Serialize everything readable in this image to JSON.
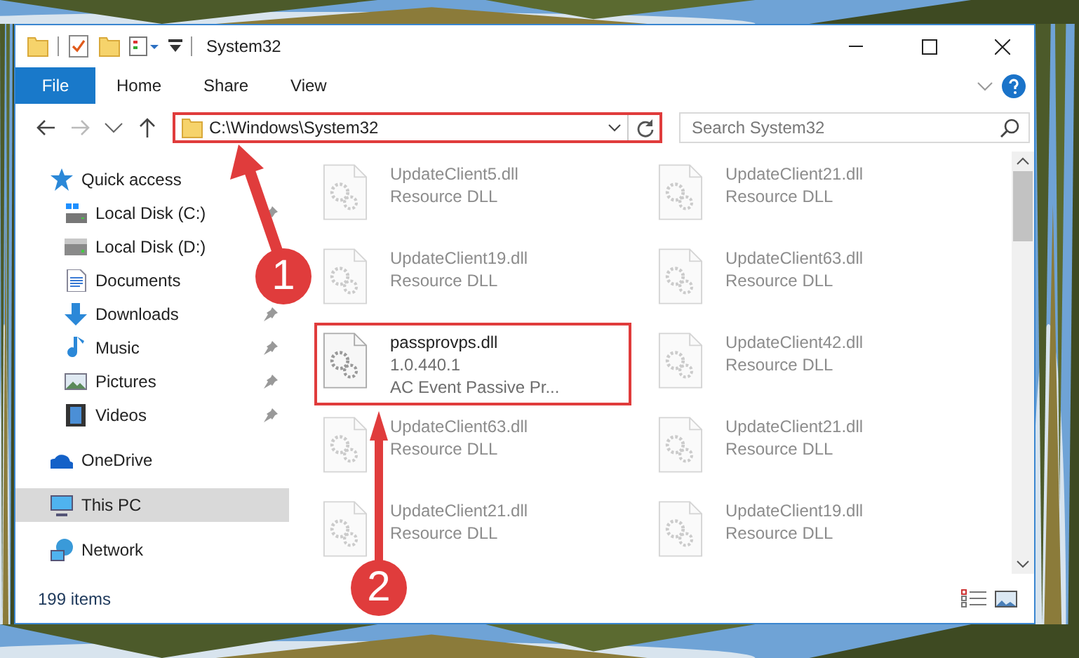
{
  "window": {
    "title": "System32"
  },
  "ribbon": {
    "file_button": "File",
    "tabs": [
      {
        "label": "Home"
      },
      {
        "label": "Share"
      },
      {
        "label": "View"
      }
    ]
  },
  "address_bar": {
    "path": "C:\\Windows\\System32",
    "highlighted": true
  },
  "search": {
    "placeholder": "Search System32"
  },
  "navigation": [
    {
      "label": "Quick access",
      "kind": "star",
      "selected": false,
      "children": [
        {
          "label": "Local Disk (C:)",
          "kind": "windows-drive",
          "pinned": true,
          "selected": false
        },
        {
          "label": "Local Disk (D:)",
          "kind": "drive",
          "pinned": false,
          "selected": false
        },
        {
          "label": "Documents",
          "kind": "documents",
          "pinned": false,
          "selected": false
        },
        {
          "label": "Downloads",
          "kind": "downloads",
          "pinned": true,
          "selected": false
        },
        {
          "label": "Music",
          "kind": "music",
          "pinned": true,
          "selected": false
        },
        {
          "label": "Pictures",
          "kind": "pictures",
          "pinned": true,
          "selected": false
        },
        {
          "label": "Videos",
          "kind": "videos",
          "pinned": true,
          "selected": false
        }
      ]
    },
    {
      "label": "OneDrive",
      "kind": "cloud",
      "selected": false
    },
    {
      "label": "This PC",
      "kind": "computer",
      "selected": true
    },
    {
      "label": "Network",
      "kind": "network",
      "selected": false
    }
  ],
  "files": [
    {
      "name": "UpdateClient5.dll",
      "line_2": "Resource DLL",
      "blurred": true,
      "highlighted": false
    },
    {
      "name": "UpdateClient21.dll",
      "line_2": "Resource DLL",
      "blurred": true,
      "highlighted": false
    },
    {
      "name": "UpdateClient19.dll",
      "line_2": "Resource DLL",
      "blurred": true,
      "highlighted": false
    },
    {
      "name": "UpdateClient63.dll",
      "line_2": "Resource DLL",
      "blurred": true,
      "highlighted": false
    },
    {
      "name": "passprovps.dll",
      "line_2": "1.0.440.1",
      "line_3": "AC Event Passive Pr...",
      "blurred": false,
      "highlighted": true
    },
    {
      "name": "UpdateClient42.dll",
      "line_2": "Resource DLL",
      "blurred": true,
      "highlighted": false
    },
    {
      "name": "UpdateClient63.dll",
      "line_2": "Resource DLL",
      "blurred": true,
      "highlighted": false
    },
    {
      "name": "UpdateClient21.dll",
      "line_2": "Resource DLL",
      "blurred": true,
      "highlighted": false
    },
    {
      "name": "UpdateClient21.dll",
      "line_2": "Resource DLL",
      "blurred": true,
      "highlighted": false
    },
    {
      "name": "UpdateClient19.dll",
      "line_2": "Resource DLL",
      "blurred": true,
      "highlighted": false
    }
  ],
  "status_bar": {
    "item_count": "199 items"
  },
  "annotations": [
    {
      "number": "1"
    },
    {
      "number": "2"
    }
  ]
}
